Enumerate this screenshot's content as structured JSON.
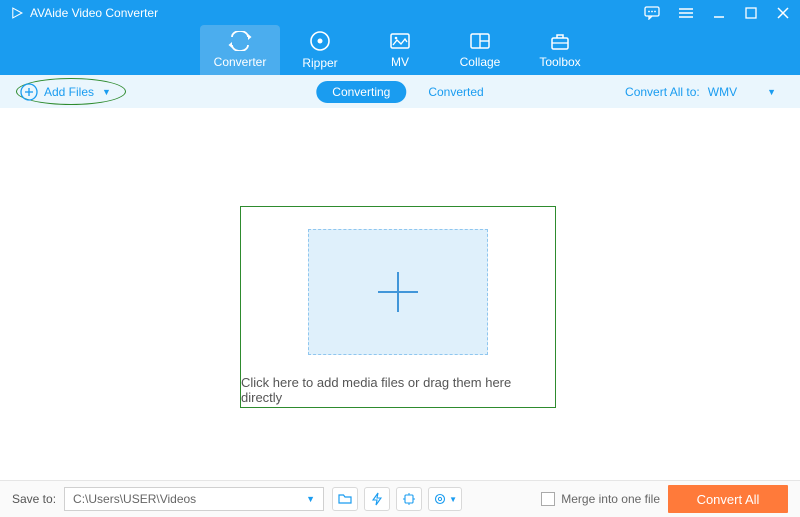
{
  "app": {
    "title": "AVAide Video Converter"
  },
  "nav": {
    "tabs": [
      {
        "label": "Converter",
        "active": true
      },
      {
        "label": "Ripper",
        "active": false
      },
      {
        "label": "MV",
        "active": false
      },
      {
        "label": "Collage",
        "active": false
      },
      {
        "label": "Toolbox",
        "active": false
      }
    ]
  },
  "subbar": {
    "add_files_label": "Add Files",
    "converting_label": "Converting",
    "converted_label": "Converted",
    "convert_all_to_label": "Convert All to:",
    "format_selected": "WMV"
  },
  "dropzone": {
    "hint": "Click here to add media files or drag them here directly"
  },
  "bottom": {
    "save_to_label": "Save to:",
    "save_path": "C:\\Users\\USER\\Videos",
    "merge_label": "Merge into one file",
    "merge_checked": false,
    "convert_btn_label": "Convert All"
  },
  "colors": {
    "primary": "#1a9cf0",
    "accent": "#ff7a3a",
    "highlight_green": "#2e8b2e"
  }
}
